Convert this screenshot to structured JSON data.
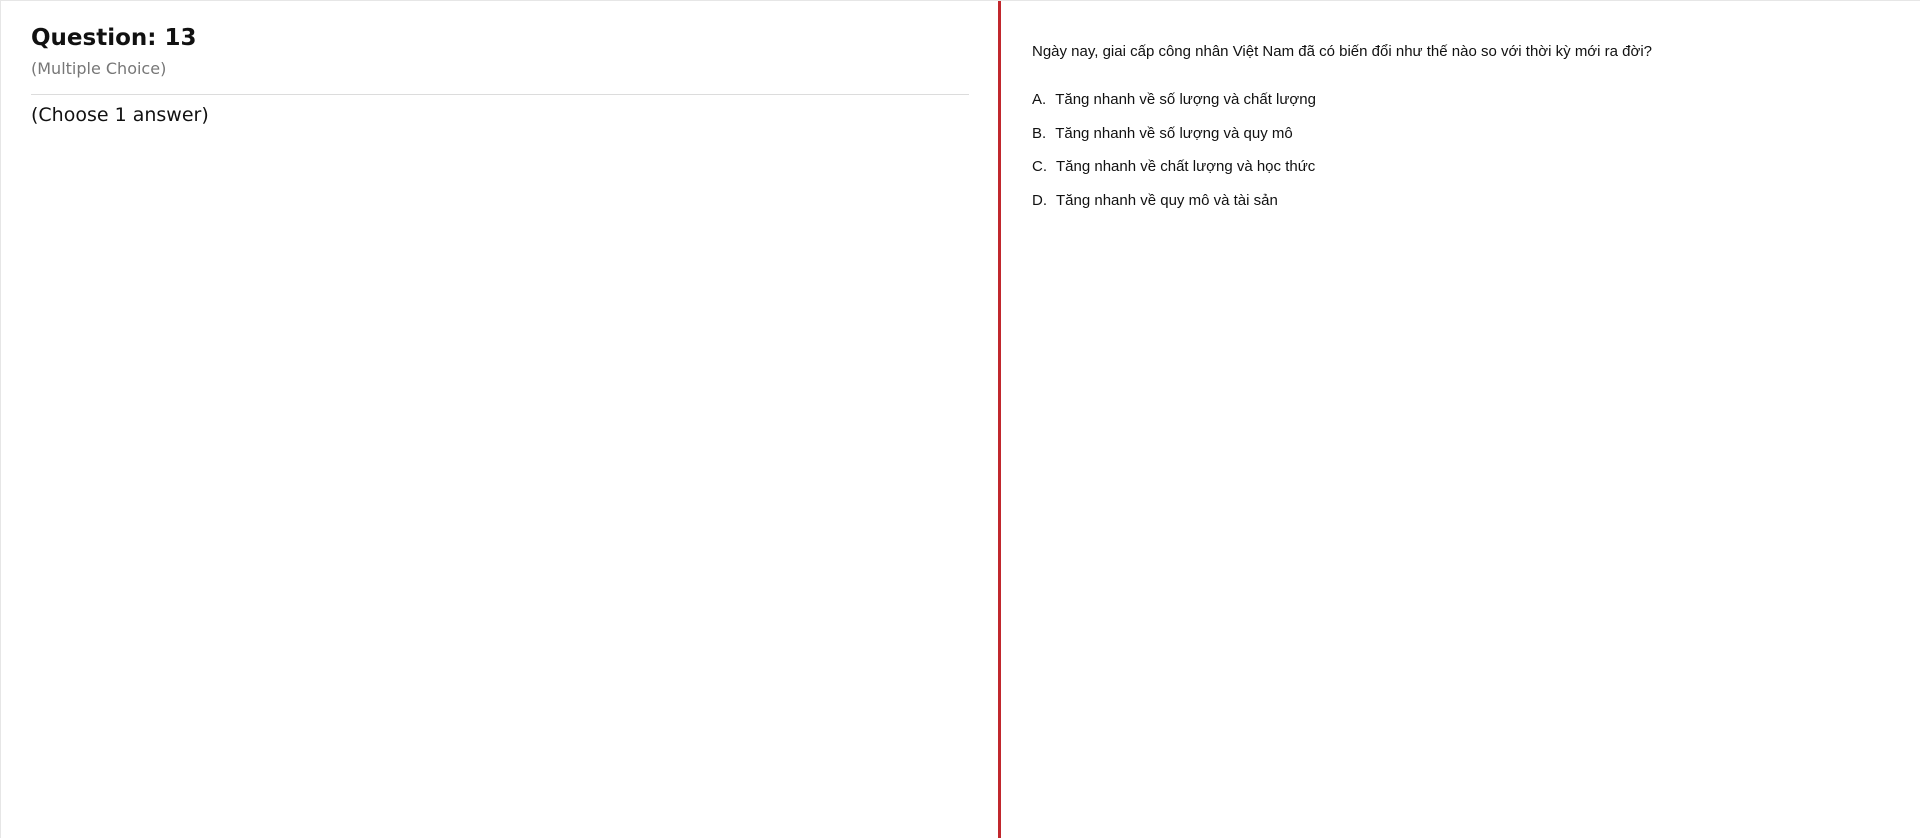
{
  "question": {
    "title": "Question: 13",
    "type": "(Multiple Choice)",
    "instruction": "(Choose 1 answer)",
    "text": "Ngày nay, giai cấp công nhân Việt Nam đã có biến đổi như thế nào so với thời kỳ mới ra đời?"
  },
  "options": [
    {
      "letter": "A.",
      "text": "Tăng nhanh về số lượng và chất lượng"
    },
    {
      "letter": "B.",
      "text": "Tăng nhanh về số lượng và quy mô"
    },
    {
      "letter": "C.",
      "text": "Tăng nhanh về chất lượng và học thức"
    },
    {
      "letter": "D.",
      "text": "Tăng nhanh về quy mô và tài sản"
    }
  ],
  "colors": {
    "divider": "#c1272d",
    "muted_text": "#777777",
    "rule": "#dcdcdc"
  }
}
